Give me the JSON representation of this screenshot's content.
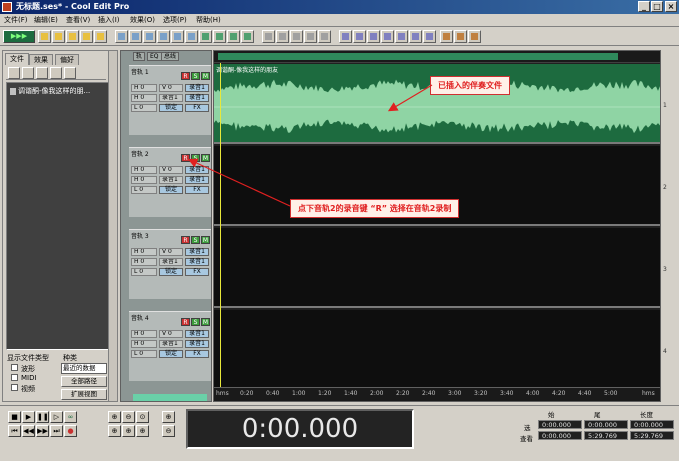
{
  "window": {
    "title": "无标题.ses* - Cool Edit Pro",
    "buttons": [
      "_",
      "□",
      "×"
    ]
  },
  "menubar": {
    "items": [
      "文件(F)",
      "编辑(E)",
      "查看(V)",
      "插入(I)",
      "效果(O)",
      "选项(P)",
      "帮助(H)"
    ]
  },
  "left_panel": {
    "tabs": [
      "文件",
      "效果",
      "偏好"
    ],
    "active_tab": "文件",
    "files": [
      "调谐酮-像我这样的朋..."
    ],
    "show_types_label": "显示文件类型",
    "sort_label": "种类",
    "types": [
      "波形",
      "MIDI",
      "视频"
    ],
    "sort_value": "最近的数据",
    "full_path_button": "全部路径",
    "expand_button": "扩展视图"
  },
  "control_panel": {
    "tabs": [
      "轨",
      "EQ",
      "总线"
    ],
    "tracks": [
      {
        "name": "音轨 1",
        "r": "R",
        "s": "S",
        "m": "M",
        "vol": "V 0",
        "pan": "H 0",
        "out1": "录音1",
        "out2": "录音1",
        "lock": "锁定",
        "lvl": "L 0",
        "fx": "FX"
      },
      {
        "name": "音轨 2",
        "r": "R",
        "s": "S",
        "m": "M",
        "vol": "V 0",
        "pan": "H 0",
        "out1": "录音1",
        "out2": "录音1",
        "lock": "锁定",
        "lvl": "L 0",
        "fx": "FX"
      },
      {
        "name": "音轨 3",
        "r": "R",
        "s": "S",
        "m": "M",
        "vol": "V 0",
        "pan": "H 0",
        "out1": "录音1",
        "out2": "录音1",
        "lock": "锁定",
        "lvl": "L 0",
        "fx": "FX"
      },
      {
        "name": "音轨 4",
        "r": "R",
        "s": "S",
        "m": "M",
        "vol": "V 0",
        "pan": "H 0",
        "out1": "录音1",
        "out2": "录音1",
        "lock": "锁定",
        "lvl": "L 0",
        "fx": "FX"
      }
    ]
  },
  "tracks_area": {
    "clip_label": "调谐酮-像我这样的朋友",
    "lane_numbers": [
      "1",
      "2",
      "3",
      "4"
    ],
    "ruler_ticks": [
      "hms",
      "0:20",
      "0:40",
      "1:00",
      "1:20",
      "1:40",
      "2:00",
      "2:20",
      "2:40",
      "3:00",
      "3:20",
      "3:40",
      "4:00",
      "4:20",
      "4:40",
      "5:00",
      "hms"
    ]
  },
  "annotations": {
    "callout_1": "已插入的伴奏文件",
    "callout_2": "点下音轨2的录音键 “R” 选择在音轨2录制"
  },
  "transport": {
    "time": "0:00.000",
    "headers": [
      "始",
      "尾",
      "长度"
    ],
    "row_labels": [
      "选",
      "查看"
    ],
    "sel_begin": "0:00.000",
    "sel_end": "0:00.000",
    "sel_length": "0:00.000",
    "view_begin": "0:00.000",
    "view_end": "5:29.769",
    "view_length": "5:29.769"
  },
  "colors": {
    "record_red": "#c83030",
    "solo_green": "#3c9c3c",
    "wave_bg": "#1d6b3f",
    "wave_fg": "#8fd4a4",
    "annotation_red": "#e02020"
  },
  "icons": [
    "play-all-icon",
    "open-icon",
    "save-icon",
    "cut-icon",
    "copy-icon",
    "paste-icon",
    "zoom-in-icon",
    "zoom-out-icon",
    "stop-icon",
    "play-icon",
    "pause-icon",
    "loop-icon",
    "record-icon"
  ]
}
